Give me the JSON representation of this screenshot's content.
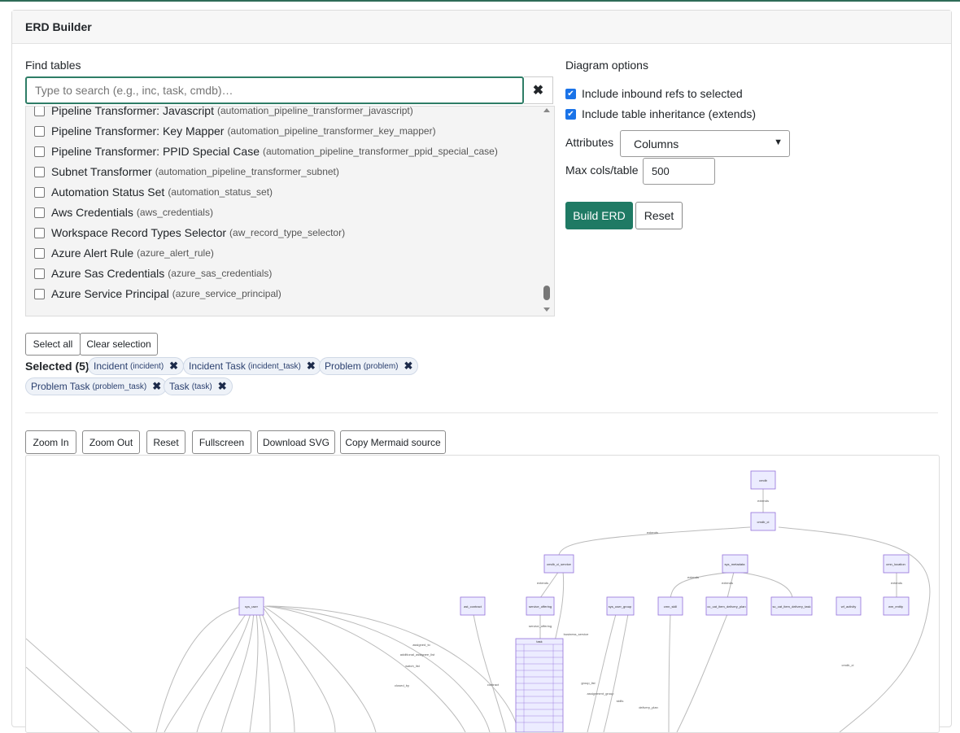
{
  "card": {
    "title": "ERD Builder"
  },
  "find": {
    "label": "Find tables",
    "placeholder": "Type to search (e.g., inc, task, cmdb)…",
    "clear_icon": "✖"
  },
  "list_items": [
    {
      "label": "Pipeline Transformer: Javascript",
      "table": "(automation_pipeline_transformer_javascript)"
    },
    {
      "label": "Pipeline Transformer: Key Mapper",
      "table": "(automation_pipeline_transformer_key_mapper)"
    },
    {
      "label": "Pipeline Transformer: PPID Special Case",
      "table": "(automation_pipeline_transformer_ppid_special_case)"
    },
    {
      "label": "Subnet Transformer",
      "table": "(automation_pipeline_transformer_subnet)"
    },
    {
      "label": "Automation Status Set",
      "table": "(automation_status_set)"
    },
    {
      "label": "Aws Credentials",
      "table": "(aws_credentials)"
    },
    {
      "label": "Workspace Record Types Selector",
      "table": "(aw_record_type_selector)"
    },
    {
      "label": "Azure Alert Rule",
      "table": "(azure_alert_rule)"
    },
    {
      "label": "Azure Sas Credentials",
      "table": "(azure_sas_credentials)"
    },
    {
      "label": "Azure Service Principal",
      "table": "(azure_service_principal)"
    }
  ],
  "options": {
    "title": "Diagram options",
    "inbound_label": "Include inbound refs to selected",
    "inbound_checked": true,
    "inheritance_label": "Include table inheritance (extends)",
    "inheritance_checked": true,
    "attributes_label": "Attributes",
    "attributes_value": "Columns",
    "maxcols_label": "Max cols/table",
    "maxcols_value": "500"
  },
  "buttons": {
    "build": "Build ERD",
    "reset": "Reset",
    "select_all": "Select all",
    "clear_selection": "Clear selection"
  },
  "selected": {
    "label": "Selected (5)",
    "chips": [
      {
        "name": "Incident",
        "table": "(incident)"
      },
      {
        "name": "Incident Task",
        "table": "(incident_task)"
      },
      {
        "name": "Problem",
        "table": "(problem)"
      },
      {
        "name": "Problem Task",
        "table": "(problem_task)"
      },
      {
        "name": "Task",
        "table": "(task)"
      }
    ]
  },
  "toolbar": {
    "zoom_in": "Zoom In",
    "zoom_out": "Zoom Out",
    "reset": "Reset",
    "fullscreen": "Fullscreen",
    "download_svg": "Download SVG",
    "copy_mermaid": "Copy Mermaid source"
  },
  "erd": {
    "nodes": [
      "cmdb",
      "cmdb_ci",
      "cmdb_ci_service",
      "sys_metadata",
      "cmn_location",
      "sys_user",
      "ast_contract",
      "service_offering",
      "sys_user_group",
      "cmn_skill",
      "cc_cat_item_delivery_plan",
      "sc_cat_item_delivery_task",
      "wf_activity",
      "wm_entity",
      "task"
    ],
    "edge_labels": [
      "extends",
      "extends",
      "extends",
      "extends",
      "extends",
      "extends",
      "assigned_to",
      "additional_assignee_list",
      "watch_list",
      "closed_by",
      "contract",
      "business_service",
      "group_list",
      "assignment_group",
      "skills",
      "delivery_plan",
      "cmdb_ci",
      "service_offering"
    ]
  }
}
